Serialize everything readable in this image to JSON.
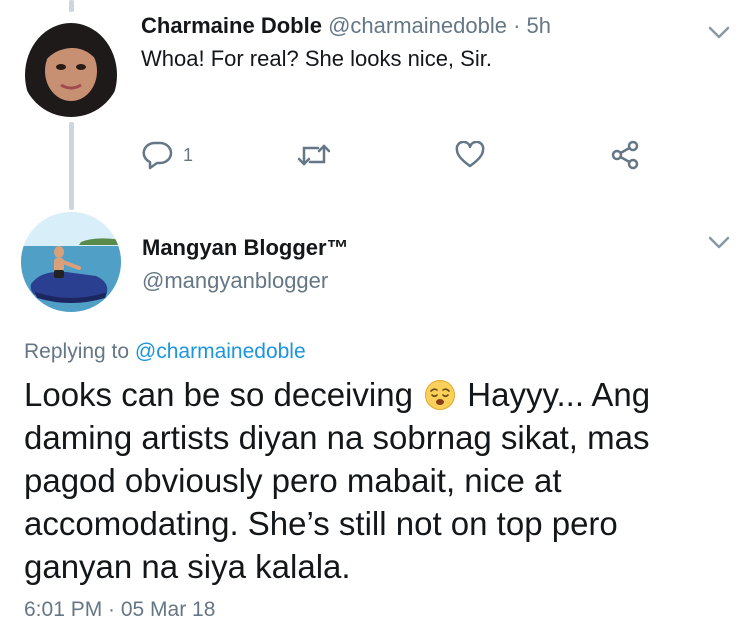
{
  "parent_tweet": {
    "author_name": "Charmaine Doble",
    "handle": "@charmainedoble",
    "separator": "·",
    "time": "5h",
    "text": "Whoa! For real? She looks nice, Sir.",
    "reply_count": "1"
  },
  "reply_tweet": {
    "author_name": "Mangyan Blogger™",
    "handle": "@mangyanblogger",
    "replying_prefix": "Replying to",
    "replying_to": "@charmainedoble",
    "text_part1": "Looks can be so deceiving",
    "emoji": "😩",
    "text_part2": "Hayyy... Ang daming artists diyan na sobrnag sikat, mas pagod obviously pero mabait, nice at accomodating. She’s still not on top pero ganyan na siya kalala.",
    "timestamp": "6:01 PM · 05 Mar 18"
  },
  "icons": {
    "more": "chevron-down-icon",
    "reply": "reply-icon",
    "retweet": "retweet-icon",
    "like": "heart-icon",
    "share": "share-icon"
  },
  "colors": {
    "link": "#1b95e0",
    "muted": "#657786",
    "thread_line": "#ccd6dd"
  }
}
